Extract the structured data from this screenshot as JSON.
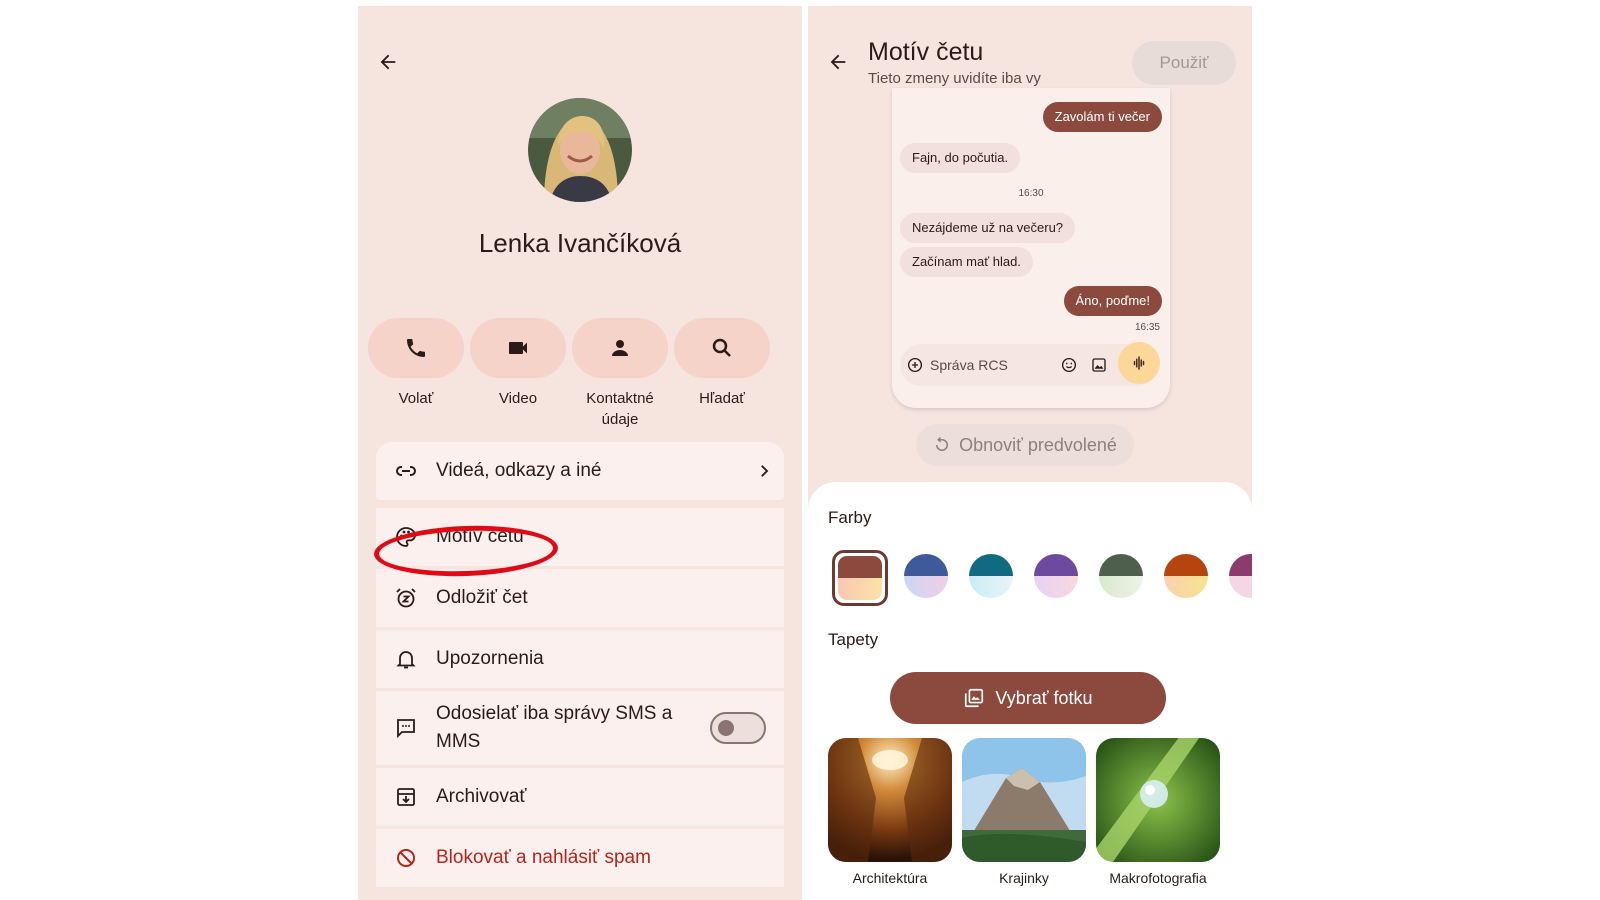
{
  "left": {
    "contact_name": "Lenka Ivančíková",
    "actions": [
      {
        "label": "Volať",
        "icon": "phone-icon"
      },
      {
        "label": "Video",
        "icon": "video-icon"
      },
      {
        "label": "Kontaktné údaje",
        "icon": "person-icon"
      },
      {
        "label": "Hľadať",
        "icon": "search-icon"
      }
    ],
    "menu": [
      {
        "label": "Videá, odkazy a iné",
        "icon": "link-icon"
      },
      {
        "label": "Motív četu",
        "icon": "palette-icon"
      },
      {
        "label": "Odložiť čet",
        "icon": "snooze-icon"
      },
      {
        "label": "Upozornenia",
        "icon": "bell-icon"
      },
      {
        "label": "Odosielať iba správy SMS a MMS",
        "icon": "sms-icon",
        "toggle": false
      },
      {
        "label": "Archivovať",
        "icon": "archive-icon"
      },
      {
        "label": "Blokovať a nahlásiť spam",
        "icon": "block-icon"
      }
    ]
  },
  "right": {
    "title": "Motív četu",
    "subtitle": "Tieto zmeny uvidíte iba vy",
    "apply_label": "Použiť",
    "preview": {
      "messages": [
        {
          "text": "Zavolám ti večer",
          "dir": "out"
        },
        {
          "text": "Fajn, do počutia.",
          "dir": "in"
        },
        {
          "text": "16:30",
          "dir": "time"
        },
        {
          "text": "Nezájdeme už na večeru?",
          "dir": "in"
        },
        {
          "text": "Začínam mať hlad.",
          "dir": "in"
        },
        {
          "text": "Áno, poďme!",
          "dir": "out"
        },
        {
          "text": "16:35",
          "dir": "time"
        }
      ],
      "composer_placeholder": "Správa RCS"
    },
    "reset_label": "Obnoviť predvolené",
    "colors_heading": "Farby",
    "colors": [
      {
        "top": "#8b4a3d",
        "bottom": "#fbe3c4",
        "selected": true
      },
      {
        "top": "#3e5a9a",
        "bottom": "#e8cdf2"
      },
      {
        "top": "#0f6a82",
        "bottom": "#d6eef5"
      },
      {
        "top": "#6d4aa0",
        "bottom": "#f5d6e6"
      },
      {
        "top": "#4f5f4d",
        "bottom": "#dde8d4"
      },
      {
        "top": "#b5440f",
        "bottom": "#fbe0a8"
      },
      {
        "top": "#8d3b6e",
        "bottom": "#f4d6e4"
      }
    ],
    "wallpapers_heading": "Tapety",
    "pick_photo_label": "Vybrať fotku",
    "wallpapers": [
      "Architektúra",
      "Krajinky",
      "Makrofotografia"
    ]
  },
  "accent_color": "#8b4a3d",
  "annotation_color": "#e00a16"
}
